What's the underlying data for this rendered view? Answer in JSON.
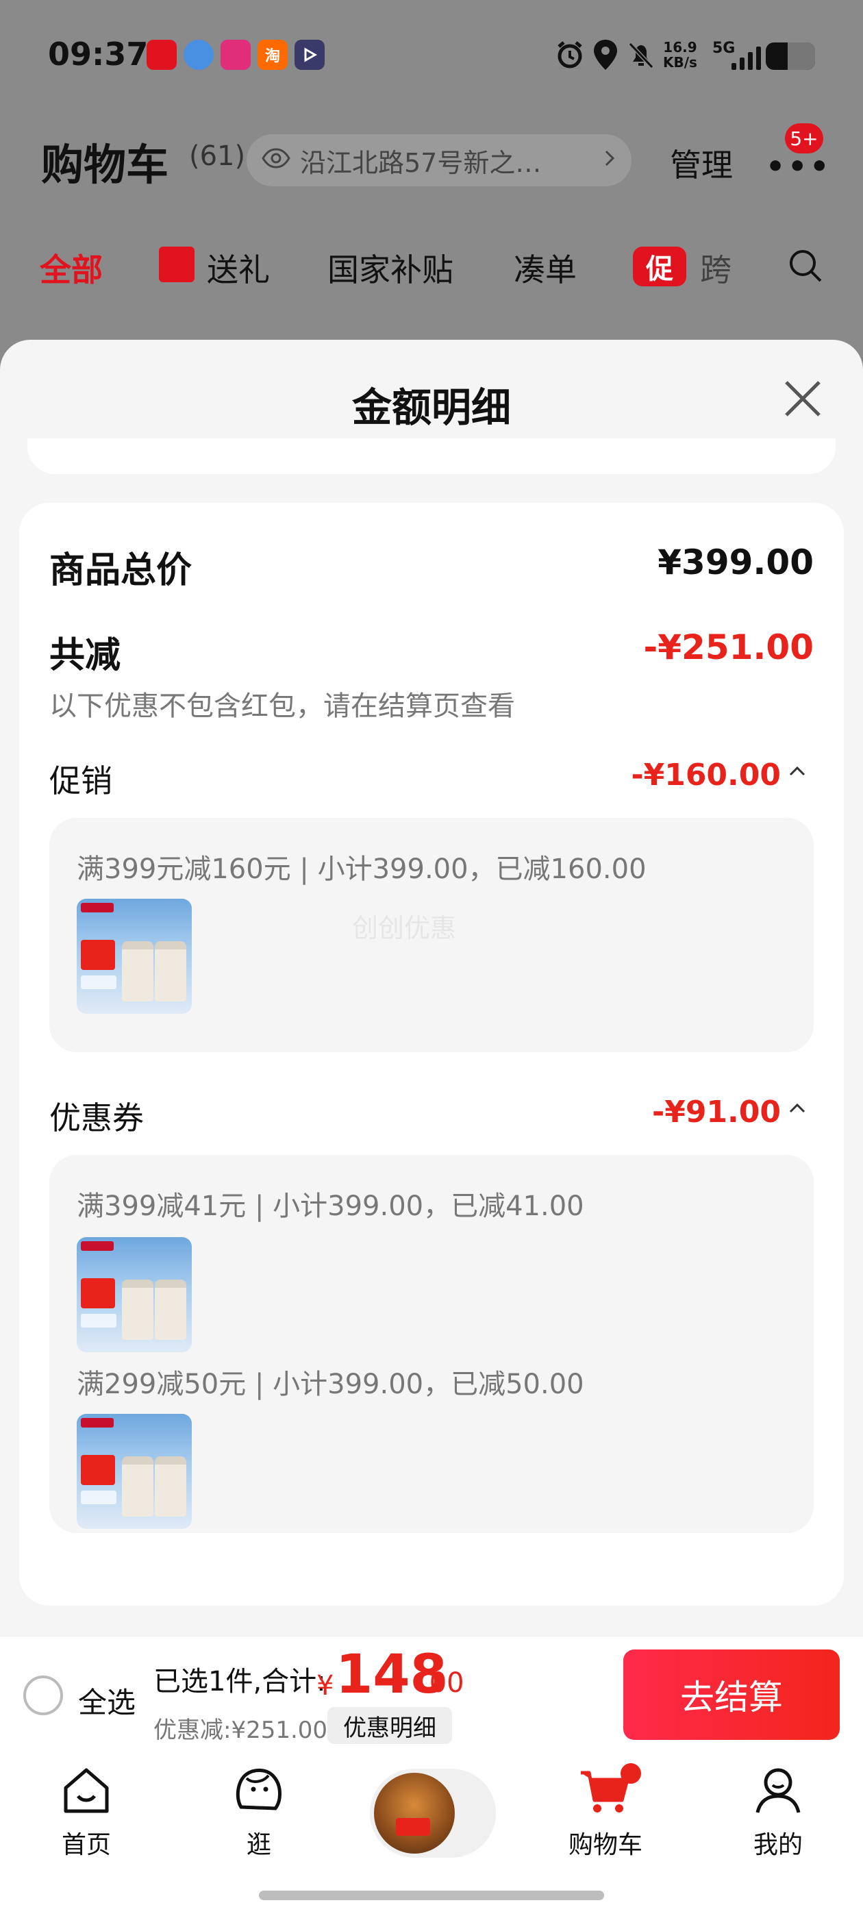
{
  "status_bar": {
    "time": "09:37",
    "apps": [
      {
        "name": "jd-app-icon",
        "label": "",
        "color": "#e1131e"
      },
      {
        "name": "assistant-app-icon",
        "label": "",
        "color": "#4a90e2"
      },
      {
        "name": "pinduoduo-app-icon",
        "label": "",
        "color": "#e02e7a"
      },
      {
        "name": "taobao-app-icon",
        "label": "淘",
        "color": "#ff6a00"
      },
      {
        "name": "video-app-icon",
        "label": "",
        "color": "#3a3a6a"
      }
    ],
    "net_speed": "16.9",
    "net_unit": "KB/s",
    "network_type": "5G",
    "battery_level": 0.55
  },
  "header": {
    "title": "购物车",
    "count": "(61)",
    "address": "沿江北路57号新之…",
    "manage": "管理",
    "more_badge": "5+"
  },
  "filter_tabs": [
    {
      "label": "全部",
      "active": true
    },
    {
      "label": "送礼"
    },
    {
      "label": "国家补贴"
    },
    {
      "label": "凑单"
    },
    {
      "label": "跨",
      "icon_text": "促"
    }
  ],
  "sheet": {
    "title": "金额明细",
    "total_label": "商品总价",
    "total_value": "¥399.00",
    "reduce_label": "共减",
    "reduce_value": "-¥251.00",
    "reduce_note": "以下优惠不包含红包，请在结算页查看",
    "promo": {
      "label": "促销",
      "amount": "-¥160.00",
      "rules": [
        {
          "text": "满399元减160元 | 小计399.00，已减160.00"
        }
      ]
    },
    "coupon": {
      "label": "优惠券",
      "amount": "-¥91.00",
      "rules": [
        {
          "text": "满399减41元 | 小计399.00，已减41.00"
        },
        {
          "text": "满299减50元 | 小计399.00，已减50.00"
        }
      ]
    },
    "watermark": "创创优惠"
  },
  "checkout": {
    "select_all": "全选",
    "selected_info": "已选1件,合计:",
    "currency": "¥",
    "total_int": "148",
    "total_dec": ".00",
    "discount_info": "优惠减:¥251.00",
    "detail_button": "优惠明细",
    "checkout_button": "去结算"
  },
  "nav": [
    {
      "label": "首页",
      "icon": "home-icon"
    },
    {
      "label": "逛",
      "icon": "browse-icon"
    },
    {
      "label": "",
      "icon": "mascot-icon"
    },
    {
      "label": "购物车",
      "icon": "cart-icon",
      "active": true
    },
    {
      "label": "我的",
      "icon": "profile-icon"
    }
  ],
  "colors": {
    "accent_red": "#e8231b",
    "brand_red": "#e1131e"
  }
}
